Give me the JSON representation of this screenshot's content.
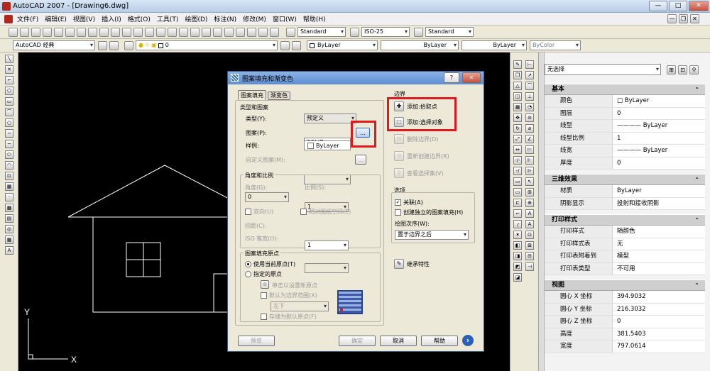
{
  "window": {
    "title": "AutoCAD 2007 - [Drawing6.dwg]",
    "btn_min": "—",
    "btn_max": "□",
    "btn_close": "✕",
    "doc_min": "—",
    "doc_restore": "❐",
    "doc_close": "✕"
  },
  "menu": [
    "文件(F)",
    "编辑(E)",
    "视图(V)",
    "插入(I)",
    "格式(O)",
    "工具(T)",
    "绘图(D)",
    "标注(N)",
    "修改(M)",
    "窗口(W)",
    "帮助(H)"
  ],
  "toolbar1": {
    "text_style": "Standard",
    "dim_style": "ISO-25",
    "table_style": "Standard"
  },
  "toolbar2": {
    "workspace": "AutoCAD 经典",
    "layer": "0",
    "color": "ByLayer",
    "linetype": "ByLayer",
    "lineweight": "ByLayer",
    "plotstyle": "ByColor"
  },
  "canvas": {
    "ucs_y": "Y",
    "ucs_x": "X"
  },
  "props": {
    "selection": "无选择",
    "sections": [
      {
        "title": "基本",
        "rows": [
          [
            "颜色",
            "□ ByLayer"
          ],
          [
            "图层",
            "0"
          ],
          [
            "线型",
            "———— ByLayer"
          ],
          [
            "线型比例",
            "1"
          ],
          [
            "线宽",
            "———— ByLayer"
          ],
          [
            "厚度",
            "0"
          ]
        ]
      },
      {
        "title": "三维效果",
        "rows": [
          [
            "材质",
            "ByLayer"
          ],
          [
            "阴影显示",
            "投射和接收阴影"
          ]
        ]
      },
      {
        "title": "打印样式",
        "rows": [
          [
            "打印样式",
            "随颜色"
          ],
          [
            "打印样式表",
            "无"
          ],
          [
            "打印表附着到",
            "模型"
          ],
          [
            "打印表类型",
            "不可用"
          ]
        ]
      },
      {
        "title": "视图",
        "rows": [
          [
            "圆心 X 坐标",
            "394.9032"
          ],
          [
            "圆心 Y 坐标",
            "216.3032"
          ],
          [
            "圆心 Z 坐标",
            "0"
          ],
          [
            "高度",
            "381.5403"
          ],
          [
            "宽度",
            "797.0614"
          ]
        ]
      }
    ]
  },
  "dialog": {
    "title": "图案填充和渐变色",
    "help_q": "?",
    "close": "✕",
    "tab_hatch": "图案填充",
    "tab_gradient": "渐变色",
    "grp_type_pattern": "类型和图案",
    "type_label": "类型(Y):",
    "type_value": "预定义",
    "pattern_label": "图案(P):",
    "pattern_value": "SOLID",
    "pattern_browse": "...",
    "swatch_label": "样例:",
    "swatch_value": "ByLayer",
    "custom_label": "自定义图案(M):",
    "custom_browse": "...",
    "grp_angle_scale": "角度和比例",
    "angle_label": "角度(G):",
    "angle_value": "0",
    "scale_label": "比例(S):",
    "scale_value": "1",
    "double_label": "双向(U)",
    "relative_label": "相对图纸空间(E)",
    "spacing_label": "间距(C):",
    "spacing_value": "1",
    "iso_label": "ISO 笔宽(O):",
    "grp_origin": "图案填充原点",
    "use_current": "使用当前原点(T)",
    "specified": "指定的原点",
    "click_set": "单击以设置新原点",
    "default_boundary": "默认为边界范围(X)",
    "boundary_pos": "左下",
    "store_default": "存储为默认原点(F)",
    "boundaries_title": "边界",
    "add_pick": "添加:拾取点",
    "add_select": "添加:选择对象",
    "remove_boundary": "删除边界(D)",
    "recreate_boundary": "重新创建边界(R)",
    "view_selection": "查看选择集(V)",
    "options_title": "选项",
    "associative": "关联(A)",
    "separate": "创建独立的图案填充(H)",
    "draw_order_label": "绘图次序(W):",
    "draw_order_value": "置于边界之后",
    "inherit": "继承特性",
    "preview": "预览",
    "ok": "确定",
    "cancel": "取消",
    "help": "帮助",
    "more": "›"
  }
}
